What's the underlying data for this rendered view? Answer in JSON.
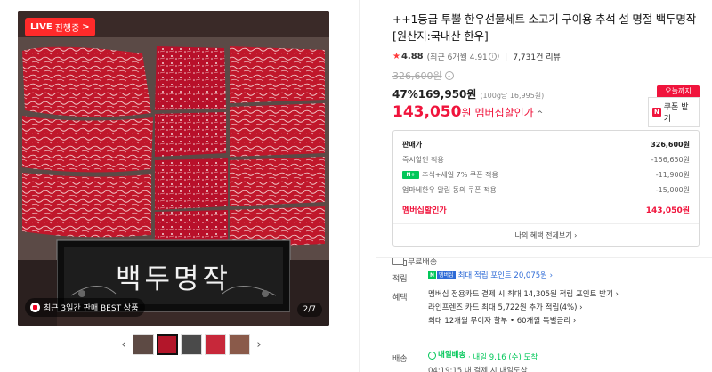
{
  "gallery": {
    "live_badge": "LIVE",
    "live_sub": "진행중",
    "live_chevron": ">",
    "box_text": "백두명작",
    "sales_badge": "최근 3일간 판매 BEST 상품",
    "page_count": "2/7",
    "prev_arrow": "‹",
    "next_arrow": "›",
    "thumb_count": 5
  },
  "product": {
    "title": "++1등급 투뿔 한우선물세트 소고기 구이용 추석 설 명절 백두명작 [원산지:국내산 한우]",
    "rating_score": "4.88",
    "rating_detail": "(최근 6개월 4.91",
    "rating_detail_end": ")",
    "review_count": "7,731건 리뷰",
    "original_price": "326,600원",
    "discount_pct": "47%",
    "discount_price": "169,950원",
    "unit_price": "(100g당 16,995원)",
    "member_price": "143,050",
    "member_price_unit": "원",
    "member_label": "멤버십할인가",
    "member_caret": "^"
  },
  "coupon": {
    "today": "오늘까지",
    "n_icon": "N",
    "label": "쿠폰 받기"
  },
  "breakdown": {
    "rows": [
      {
        "label": "판매가",
        "value": "326,600원"
      },
      {
        "label": "즉시할인 적용",
        "value": "-156,650원"
      },
      {
        "label": "추석+세일 7% 쿠폰 적용",
        "value": "-11,900원"
      },
      {
        "label": "엄마네한우 알림 동의 쿠폰 적용",
        "value": "-15,000원"
      }
    ],
    "np_icon": "N+",
    "final_label": "멤버십할인가",
    "final_value": "143,050원",
    "benefit_link": "나의 혜택 전체보기 ›"
  },
  "shipping": {
    "label": "무료배송"
  },
  "points": {
    "label": "적립",
    "badge_left": "N",
    "badge_right": "멤버십",
    "text": "최대 적립 포인트 20,075원 ›"
  },
  "benefits": {
    "label": "혜택",
    "lines": [
      "멤버십 전용카드 결제 시 최대 14,305원 적립 포인트 받기 ›",
      "라인프렌즈 카드 최대 5,722원 추가 적립(4%) ›",
      "최대 12개월 무이자 할부 • 60개월 특별금리 ›"
    ]
  },
  "delivery": {
    "label": "배송",
    "badge": "내일배송",
    "text": "· 내일 9.16 (수) 도착",
    "sub": "04:19:15  내 결제 시 내일도착"
  },
  "colors": {
    "accent_red": "#f0143c",
    "naver_green": "#03c75a"
  }
}
